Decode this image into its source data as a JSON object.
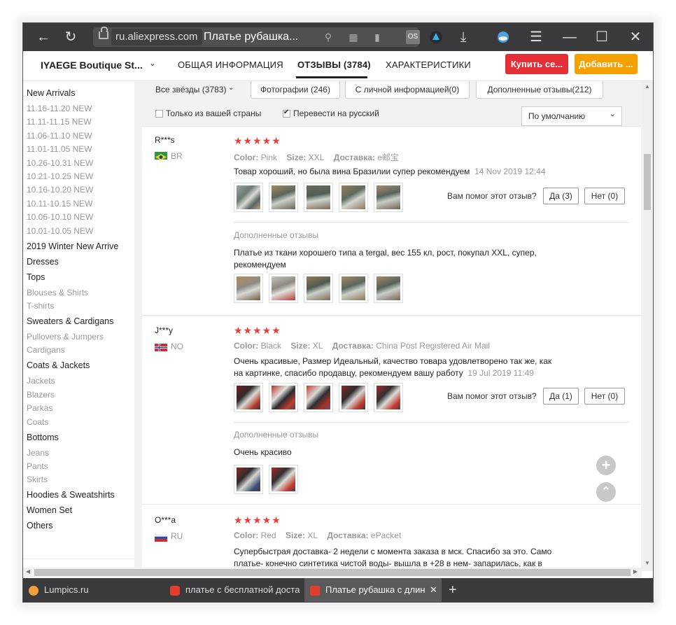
{
  "browser": {
    "domain": "ru.aliexpress.com",
    "page_title": "Платье рубашка...",
    "ext_os_label": "OS"
  },
  "store": {
    "name": "IYAEGE Boutique St...",
    "tabs": [
      {
        "label": "ОБЩАЯ ИНФОРМАЦИЯ"
      },
      {
        "label": "ОТЗЫВЫ (3784)"
      },
      {
        "label": "ХАРАКТЕРИСТИКИ"
      }
    ],
    "buy_label": "Купить се...",
    "add_label": "Добавить ..."
  },
  "sidebar": {
    "items": [
      {
        "label": "New Arrivals",
        "heading": true
      },
      {
        "label": "11.16-11.20 NEW"
      },
      {
        "label": "11.11-11.15 NEW"
      },
      {
        "label": "11.06-11.10 NEW"
      },
      {
        "label": "11.01-11.05 NEW"
      },
      {
        "label": "10.26-10.31 NEW"
      },
      {
        "label": "10.21-10.25 NEW"
      },
      {
        "label": "10.16-10.20 NEW"
      },
      {
        "label": "10.11-10.15 NEW"
      },
      {
        "label": "10.06-10.10 NEW"
      },
      {
        "label": "10.01-10.05 NEW"
      },
      {
        "label": "2019 Winter New Arrive",
        "heading": true
      },
      {
        "label": "Dresses",
        "heading": true
      },
      {
        "label": "Tops",
        "heading": true
      },
      {
        "label": "Blouses & Shirts"
      },
      {
        "label": "T-shirts"
      },
      {
        "label": "Sweaters & Cardigans",
        "heading": true
      },
      {
        "label": "Pullovers & Jumpers"
      },
      {
        "label": "Cardigans"
      },
      {
        "label": "Coats & Jackets",
        "heading": true
      },
      {
        "label": "Jackets"
      },
      {
        "label": "Blazers"
      },
      {
        "label": "Parkas"
      },
      {
        "label": "Coats"
      },
      {
        "label": "Bottoms",
        "heading": true
      },
      {
        "label": "Jeans"
      },
      {
        "label": "Pants"
      },
      {
        "label": "Skirts"
      },
      {
        "label": "Hoodies & Sweatshirts",
        "heading": true
      },
      {
        "label": "Women Set",
        "heading": true
      },
      {
        "label": "Others",
        "heading": true
      }
    ]
  },
  "filters": {
    "stars": "Все звёзды (3783)",
    "photos": "Фотографии (246)",
    "personal": "С личной информацией(0)",
    "additional": "Дополненные отзывы(212)",
    "only_country": "Только из вашей страны",
    "translate": "Перевести на русский",
    "sort": "По умолчанию"
  },
  "labels": {
    "helpful": "Вам помог этот отзыв?",
    "additional_reviews": "Дополненные отзывы",
    "color": "Color:",
    "size": "Size:",
    "delivery": "Доставка:"
  },
  "reviews": [
    {
      "name": "R***s",
      "country": "BR",
      "stars": "★★★★★",
      "color": "Pink",
      "size": "XXL",
      "delivery": "e邮宝",
      "text": "Товар хороший, но была вина Бразилии супер рекомендуем",
      "date": "14 Nov 2019 12:44",
      "yes": "Да (3)",
      "no": "Нет (0)",
      "additional_text": "Платье из ткани хорошего типа a tergal, вес 155 кл, рост, покупал XXL, супер, рекомендуем"
    },
    {
      "name": "J***y",
      "country": "NO",
      "stars": "★★★★★",
      "color": "Black",
      "size": "XL",
      "delivery": "China Post Registered Air Mail",
      "text": "Очень красивые, Размер Идеальный, качество товара удовлетворено так же, как на картинке, спасибо продавцу, рекомендуем вашу работу",
      "date": "19 Jul 2019 11:49",
      "yes": "Да (1)",
      "no": "Нет (0)",
      "additional_text": "Очень красиво"
    },
    {
      "name": "O***a",
      "country": "RU",
      "stars": "★★★★★",
      "color": "Red",
      "size": "XL",
      "delivery": "ePacket",
      "text": "Супербыстрая доставка- 2 недели с момента заказа в мск. Спасибо за это. Само платье- конечно синтетика чистой воды- вышла в +28 в нем- запарилась, как в"
    }
  ],
  "bottom_tabs": [
    {
      "label": "Lumpics.ru"
    },
    {
      "label": "платье с бесплатной доста"
    },
    {
      "label": "Платье рубашка с длин"
    }
  ],
  "colors": {
    "accent_red": "#e62e36",
    "accent_orange": "#f7a100",
    "star_red": "#ee3b3b"
  }
}
